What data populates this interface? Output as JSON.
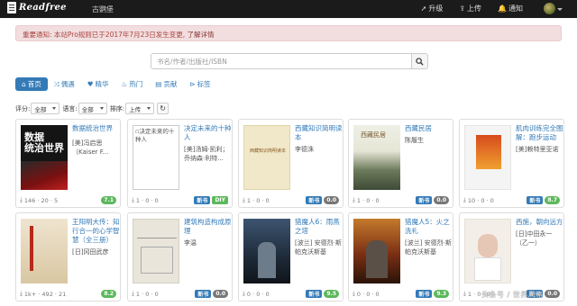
{
  "navbar": {
    "brand": "Readfree",
    "user": "古鹦堡",
    "upgrade": "升级",
    "upload": "上传",
    "notice": "通知"
  },
  "alert": {
    "text": "重要通知: 本站Pro规则已于2017年7月23日发生变更, ",
    "link": "了解详情"
  },
  "search": {
    "placeholder": "书名/作者/出版社/ISBN"
  },
  "tabs": [
    {
      "label": "首页"
    },
    {
      "label": "偶遇"
    },
    {
      "label": "精华"
    },
    {
      "label": "热门"
    },
    {
      "label": "贡献"
    },
    {
      "label": "标签"
    }
  ],
  "filter": {
    "rating_label": "评分:",
    "rating_value": "全部",
    "lang_label": "语言:",
    "lang_value": "全部",
    "sort_label": "排序:",
    "sort_value": "上传"
  },
  "books": [
    {
      "title": "数据统治世界",
      "author": "[美]冯启思（Kaiser F...",
      "stats": "146 · 20 · 5",
      "badges": [],
      "score": "7.1"
    },
    {
      "title": "决定未来的十种人",
      "author": "[美]汤姆·凯利；乔纳森·利特...",
      "stats": "1 · 0 · 0",
      "badges": [
        "新书",
        "DIY"
      ],
      "score": ""
    },
    {
      "title": "西藏知识简明读本",
      "author": "李德洙",
      "stats": "1 · 0 · 0",
      "badges": [
        "新书"
      ],
      "score": "0.0"
    },
    {
      "title": "西藏民居",
      "author": "陈履生",
      "stats": "1 · 0 · 0",
      "badges": [
        "新书"
      ],
      "score": "0.0"
    },
    {
      "title": "肌肉训练完全图解：跑步运动",
      "author": "[美]赖特里亚诺",
      "stats": "10 · 0 · 0",
      "badges": [
        "新书"
      ],
      "score": "8.7"
    },
    {
      "title": "王阳明大传：知行合一的心学智慧（全三册）",
      "author": "[日]冈田武彦",
      "stats": "1k+ · 492 · 21",
      "badges": [],
      "score": "8.2"
    },
    {
      "title": "建筑构造构成原理",
      "author": "李温",
      "stats": "1 · 0 · 0",
      "badges": [
        "新书"
      ],
      "score": "0.0"
    },
    {
      "title": "猎魔人6：雨燕之塔",
      "author": "[波兰] 安德烈·斯帕克沃斯基",
      "stats": "0 · 0 · 0",
      "badges": [
        "新书"
      ],
      "score": "9.5"
    },
    {
      "title": "猎魔人5：火之洗礼",
      "author": "[波兰] 安德烈·斯帕克沃斯基",
      "stats": "0 · 0 · 0",
      "badges": [
        "新书"
      ],
      "score": "9.3"
    },
    {
      "title": "西施，朝向远方",
      "author": "[日]中田永一（乙一）",
      "stats": "1 · 0 · 0",
      "badges": [
        "新书"
      ],
      "score": "0.0"
    }
  ],
  "watermark": "头条号 / 世界风格"
}
